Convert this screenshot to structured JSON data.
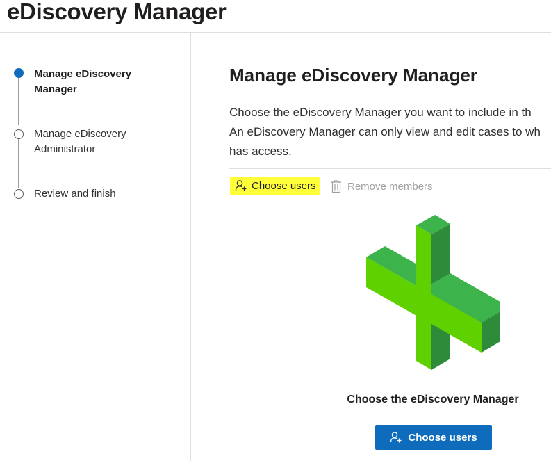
{
  "header": {
    "title": "eDiscovery Manager"
  },
  "wizard": {
    "steps": [
      {
        "label": "Manage eDiscovery Manager",
        "state": "active"
      },
      {
        "label": "Manage eDiscovery Administrator",
        "state": "pending"
      },
      {
        "label": "Review and finish",
        "state": "pending"
      }
    ]
  },
  "main": {
    "heading": "Manage eDiscovery Manager",
    "description_lines": [
      "Choose the eDiscovery Manager you want to include in th",
      "An eDiscovery Manager can only view and edit cases to wh",
      "has access."
    ]
  },
  "toolbar": {
    "choose_users_label": "Choose users",
    "choose_users_icon": "add-person-icon",
    "remove_members_label": "Remove members",
    "remove_members_icon": "trash-icon"
  },
  "empty_state": {
    "illustration": "green-plus-icon",
    "title": "Choose the eDiscovery Manager",
    "button_label": "Choose users",
    "button_icon": "add-person-icon"
  },
  "colors": {
    "accent": "#0f6cbd",
    "highlight": "#ffff3a",
    "plus_light": "#5fd000",
    "plus_mid": "#3cb44b",
    "plus_dark": "#2e8b3a",
    "disabled_text": "#a19f9d"
  }
}
